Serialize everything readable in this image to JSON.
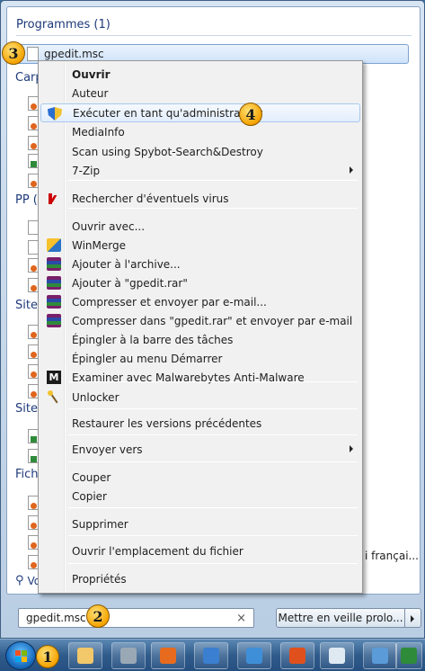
{
  "results": {
    "programs_header": "Programmes (1)",
    "selected_item": "gpedit.msc",
    "partial_headers": [
      "Carp",
      "PP (",
      "Sites",
      "Sites",
      "Fich"
    ],
    "search_more_partial": "Vo",
    "right_snippet": "i françai..."
  },
  "context_menu": {
    "items": [
      {
        "label": "Ouvrir",
        "bold": true
      },
      {
        "label": "Auteur"
      },
      {
        "label": "Exécuter en tant qu'administrateur",
        "icon": "uac-shield-icon",
        "hover": true
      },
      {
        "label": "MediaInfo"
      },
      {
        "label": "Scan using Spybot-Search&Destroy"
      },
      {
        "label": "7-Zip",
        "submenu": true
      },
      {
        "label": "Rechercher d'éventuels virus",
        "icon": "kaspersky-icon"
      },
      {
        "label": "Ouvrir avec..."
      },
      {
        "label": "WinMerge",
        "icon": "winmerge-icon"
      },
      {
        "label": "Ajouter à l'archive...",
        "icon": "winrar-icon"
      },
      {
        "label": "Ajouter à \"gpedit.rar\"",
        "icon": "winrar-icon"
      },
      {
        "label": "Compresser et envoyer par e-mail...",
        "icon": "winrar-icon"
      },
      {
        "label": "Compresser dans \"gpedit.rar\" et envoyer par e-mail",
        "icon": "winrar-icon"
      },
      {
        "label": "Épingler à la barre des tâches"
      },
      {
        "label": "Épingler au menu Démarrer"
      },
      {
        "label": "Examiner avec Malwarebytes Anti-Malware",
        "icon": "malwarebytes-icon"
      },
      {
        "label": "Unlocker",
        "icon": "unlocker-wand-icon"
      },
      {
        "label": "Restaurer les versions précédentes"
      },
      {
        "label": "Envoyer vers",
        "submenu": true
      },
      {
        "label": "Couper"
      },
      {
        "label": "Copier"
      },
      {
        "label": "Supprimer"
      },
      {
        "label": "Ouvrir l'emplacement du fichier"
      },
      {
        "label": "Propriétés"
      }
    ]
  },
  "search": {
    "value": "gpedit.msc",
    "clear_glyph": "×"
  },
  "power": {
    "button_label": "Mettre en veille prolo..."
  },
  "badges": [
    "1",
    "2",
    "3",
    "4"
  ],
  "taskbar": {
    "buttons": [
      "explorer-icon",
      "taskman-icon",
      "firefox-icon",
      "thunderbird-icon",
      "sync-icon",
      "kt-icon",
      "notepad-icon",
      "scanner-icon",
      "excel-icon"
    ]
  }
}
